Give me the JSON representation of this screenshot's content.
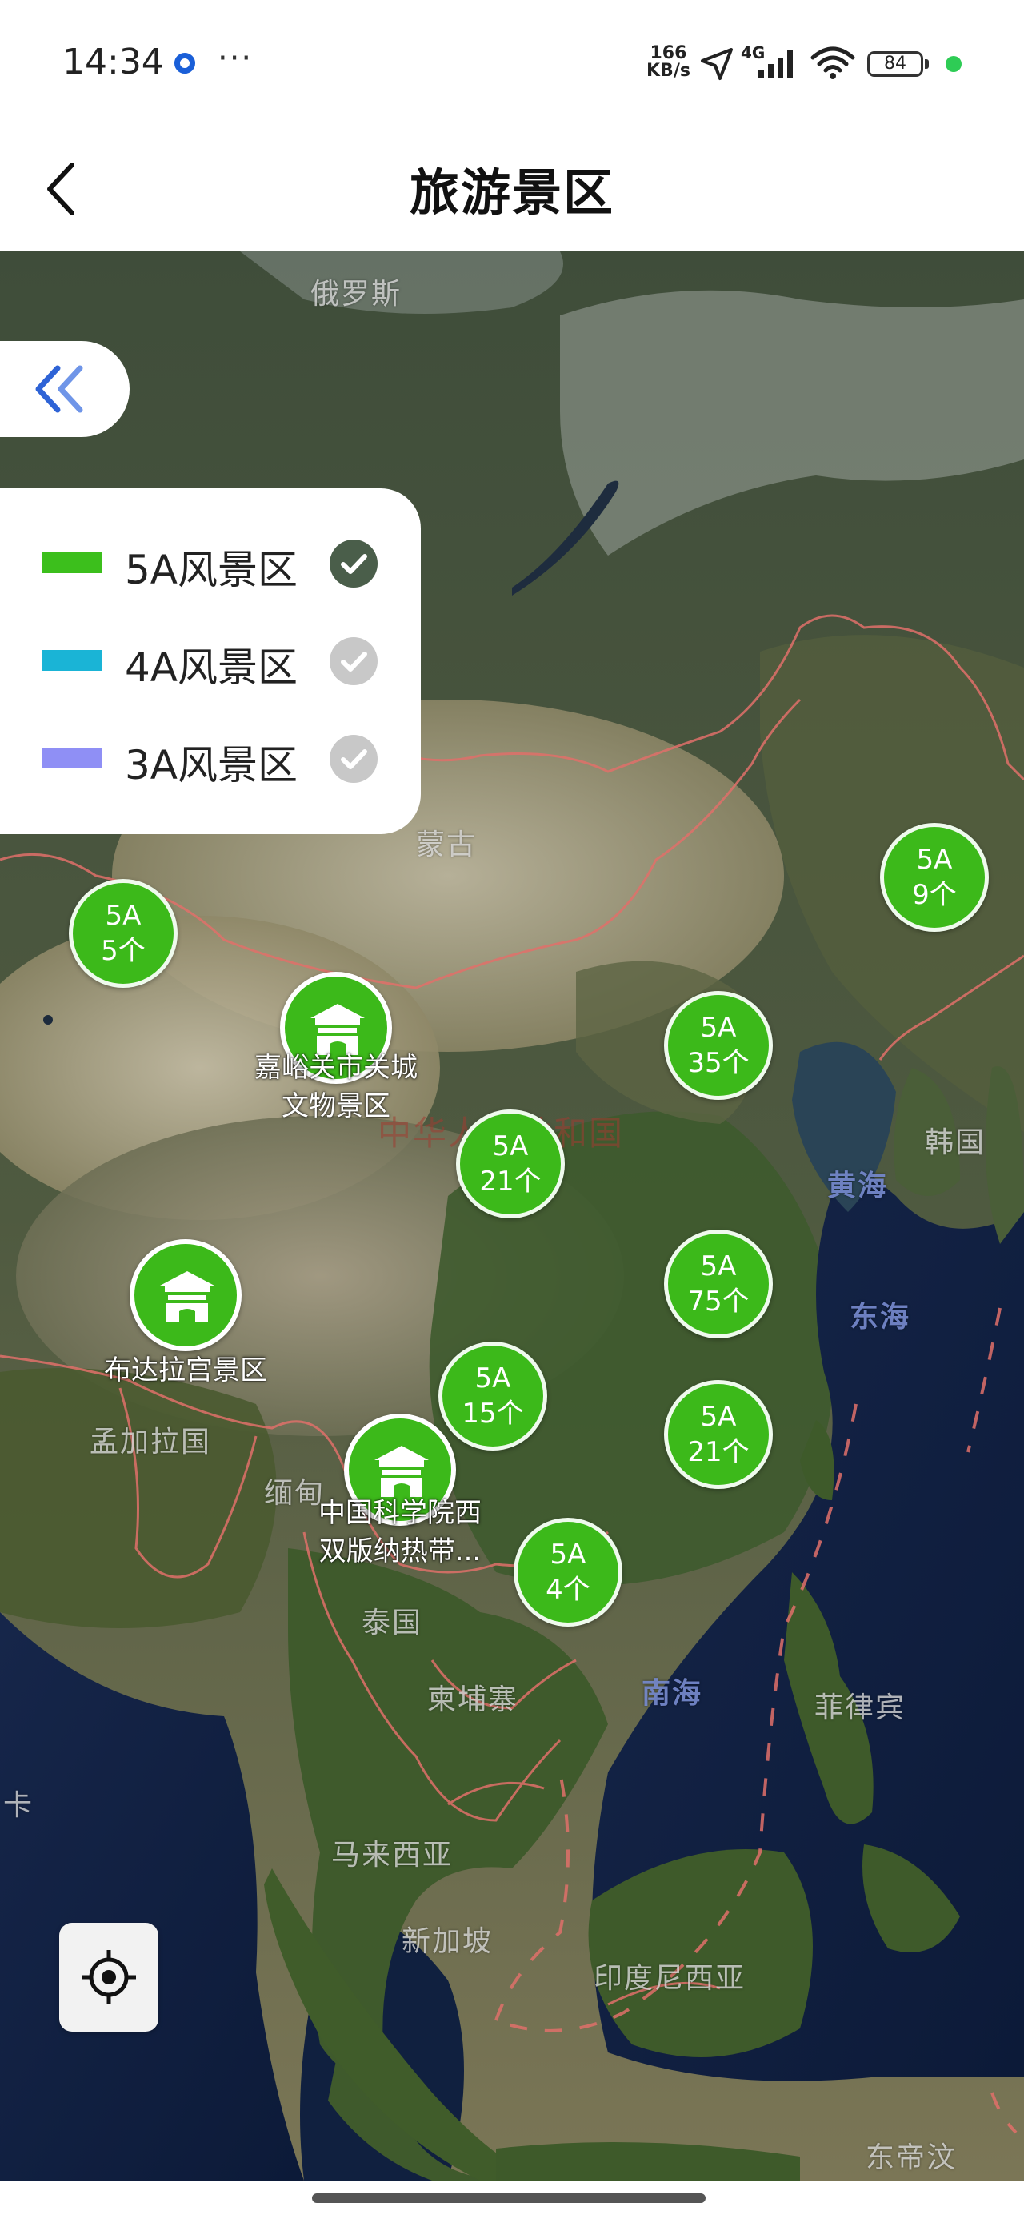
{
  "status_bar": {
    "time": "14:34",
    "speed_value": "166",
    "speed_unit": "KB/s",
    "network": "4G",
    "battery": "84",
    "icons": [
      "app-notification-icon",
      "more-dots-icon",
      "location-arrow-icon",
      "cellular-signal-icon",
      "wifi-icon",
      "battery-icon"
    ]
  },
  "header": {
    "title": "旅游景区",
    "back_icon": "chevron-left-icon"
  },
  "map": {
    "places": {
      "russia": "俄罗斯",
      "mongolia": "蒙古",
      "china": "中华人民共和国",
      "korea": "韩国",
      "yellow_sea": "黄海",
      "east_sea": "东海",
      "bangladesh": "孟加拉国",
      "myanmar": "缅甸",
      "thailand": "泰国",
      "cambodia": "柬埔寨",
      "south_sea": "南海",
      "philippines": "菲律宾",
      "malaysia": "马来西亚",
      "singapore": "新加坡",
      "indonesia": "印度尼西亚",
      "east_timor": "东帝汶",
      "lanka": "卡"
    },
    "clusters": [
      {
        "level": "5A",
        "count": "5个"
      },
      {
        "level": "5A",
        "count": "9个"
      },
      {
        "level": "5A",
        "count": "35个"
      },
      {
        "level": "5A",
        "count": "21个"
      },
      {
        "level": "5A",
        "count": "75个"
      },
      {
        "level": "5A",
        "count": "15个"
      },
      {
        "level": "5A",
        "count": "21个"
      },
      {
        "level": "5A",
        "count": "4个"
      }
    ],
    "pois": [
      {
        "line1": "嘉峪关市关城",
        "line2": "文物景区"
      },
      {
        "line1": "布达拉宫景区",
        "line2": ""
      },
      {
        "line1": "中国科学院西",
        "line2": "双版纳热带..."
      }
    ],
    "marker_color": "#3cb91a"
  },
  "legend": {
    "items": [
      {
        "label": "5A风景区",
        "color": "#3cbf1c",
        "checked": true
      },
      {
        "label": "4A风景区",
        "color": "#1ab4d6",
        "checked": false
      },
      {
        "label": "3A风景区",
        "color": "#8f8ff5",
        "checked": false
      }
    ],
    "collapse_icon": "double-chevron-left-icon"
  },
  "controls": {
    "locate_icon": "locate-crosshair-icon"
  }
}
